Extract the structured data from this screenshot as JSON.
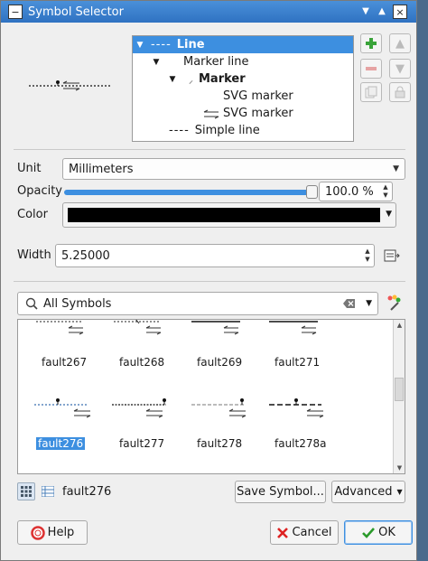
{
  "window": {
    "title": "Symbol Selector"
  },
  "tree": {
    "items": [
      {
        "label": "Line",
        "prefix": "----"
      },
      {
        "label": "Marker line"
      },
      {
        "label": "Marker"
      },
      {
        "label": "SVG marker"
      },
      {
        "label": "SVG marker"
      },
      {
        "label": "Simple line",
        "prefix": "----"
      }
    ]
  },
  "unit": {
    "label": "Unit",
    "value": "Millimeters"
  },
  "opacity": {
    "label": "Opacity",
    "value": "100.0 %",
    "fraction": 1.0
  },
  "color": {
    "label": "Color",
    "value": "#000000"
  },
  "width": {
    "label": "Width",
    "value": "5.25000"
  },
  "search": {
    "value": "All Symbols"
  },
  "symbols": [
    {
      "name": "fault267"
    },
    {
      "name": "fault268"
    },
    {
      "name": "fault269"
    },
    {
      "name": "fault271"
    },
    {
      "name": "fault276"
    },
    {
      "name": "fault277"
    },
    {
      "name": "fault278"
    },
    {
      "name": "fault278a"
    }
  ],
  "footer": {
    "selected_name": "fault276",
    "save_label": "Save Symbol...",
    "advanced_label": "Advanced"
  },
  "buttons": {
    "help": "Help",
    "cancel": "Cancel",
    "ok": "OK"
  },
  "colors": {
    "accent": "#3d8fe0",
    "title_bar": "#3b84d0"
  }
}
